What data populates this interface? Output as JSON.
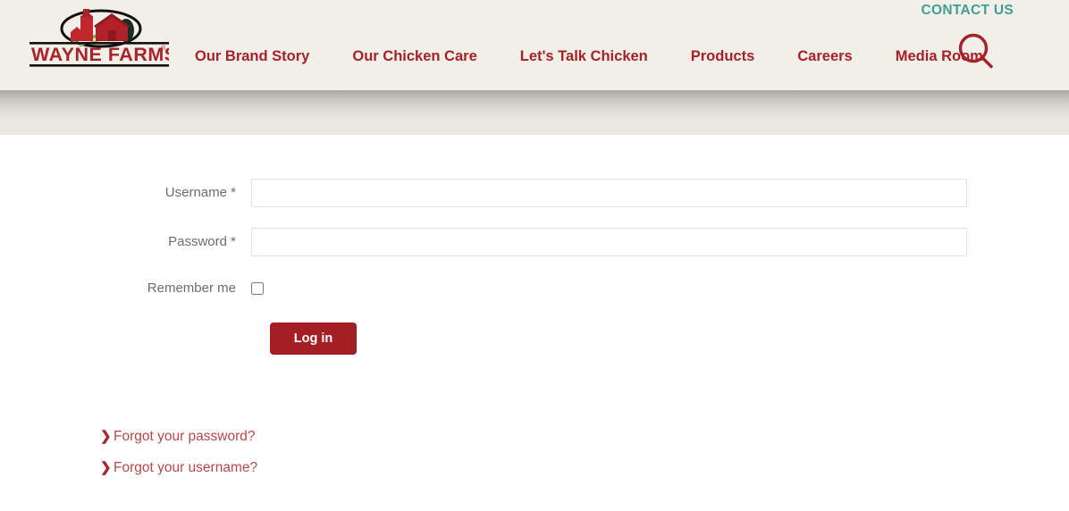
{
  "header": {
    "logo": {
      "name": "wayne-farms-logo",
      "wordmark": "WAYNE FARMS",
      "registered_mark": "®",
      "colors": {
        "barn_red": "#b22128",
        "silo_red": "#c0282e",
        "tree_green": "#1d3d2a",
        "grass_green": "#7cb342",
        "rule_black": "#111111"
      }
    },
    "utility": {
      "contact_label": "CONTACT US",
      "contact_color": "#3f9e96"
    },
    "nav": {
      "accent_color": "#a52229",
      "items": [
        {
          "label": "Our Brand Story",
          "name": "nav-our-brand-story"
        },
        {
          "label": "Our Chicken Care",
          "name": "nav-our-chicken-care"
        },
        {
          "label": "Let's Talk Chicken",
          "name": "nav-lets-talk-chicken"
        },
        {
          "label": "Products",
          "name": "nav-products"
        },
        {
          "label": "Careers",
          "name": "nav-careers"
        },
        {
          "label": "Media Room",
          "name": "nav-media-room"
        }
      ]
    },
    "search": {
      "icon": "search-icon",
      "color": "#a52229"
    },
    "background_color": "#f2efe9"
  },
  "login": {
    "username": {
      "label": "Username *",
      "value": "",
      "placeholder": ""
    },
    "password": {
      "label": "Password *",
      "value": "",
      "placeholder": ""
    },
    "remember": {
      "label": "Remember me",
      "checked": false
    },
    "submit_label": "Log in",
    "submit_color": "#a41f23",
    "links": [
      {
        "chevron": "❯",
        "label": "Forgot your password?",
        "name": "forgot-password-link"
      },
      {
        "chevron": "❯",
        "label": "Forgot your username?",
        "name": "forgot-username-link"
      }
    ],
    "link_color": "#b8474b"
  }
}
